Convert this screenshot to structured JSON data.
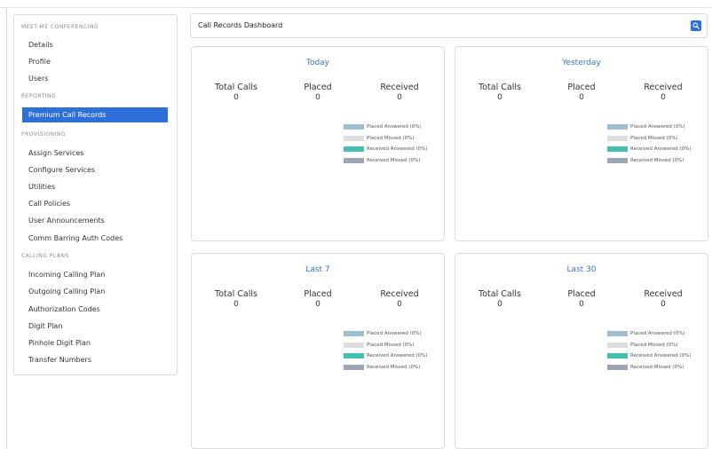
{
  "sidebar": {
    "sections": [
      {
        "heading": "MEET-ME CONFERENCING",
        "items": [
          "Details",
          "Profile",
          "Users"
        ]
      },
      {
        "heading": "REPORTING",
        "items": [
          "Premium Call Records"
        ]
      },
      {
        "heading": "PROVISIONING",
        "items": [
          "Assign Services",
          "Configure Services",
          "Utilities",
          "Call Policies",
          "User Announcements",
          "Comm Barring Auth Codes"
        ]
      },
      {
        "heading": "CALLING PLANS",
        "items": [
          "Incoming Calling Plan",
          "Outgoing Calling Plan",
          "Authorization Codes",
          "Digit Plan",
          "Pinhole Digit Plan",
          "Transfer Numbers"
        ]
      }
    ],
    "active_item": "Premium Call Records"
  },
  "header": {
    "title": "Call Records Dashboard",
    "search_icon": "search-icon"
  },
  "stat_labels": {
    "total": "Total Calls",
    "placed": "Placed",
    "received": "Received"
  },
  "legend": [
    {
      "label": "Placed Answered (0%)",
      "color": "#9fbfd1"
    },
    {
      "label": "Placed Missed (0%)",
      "color": "#dedede"
    },
    {
      "label": "Received Answered (0%)",
      "color": "#45bfb1"
    },
    {
      "label": "Received Missed (0%)",
      "color": "#9aa5b5"
    }
  ],
  "cards": [
    {
      "title": "Today",
      "total": "0",
      "placed": "0",
      "received": "0"
    },
    {
      "title": "Yesterday",
      "total": "0",
      "placed": "0",
      "received": "0"
    },
    {
      "title": "Last 7",
      "total": "0",
      "placed": "0",
      "received": "0"
    },
    {
      "title": "Last 30",
      "total": "0",
      "placed": "0",
      "received": "0"
    }
  ],
  "colors": {
    "accent": "#2f6fd8",
    "card_title": "#3a76c6",
    "border": "#dcdcdc"
  }
}
